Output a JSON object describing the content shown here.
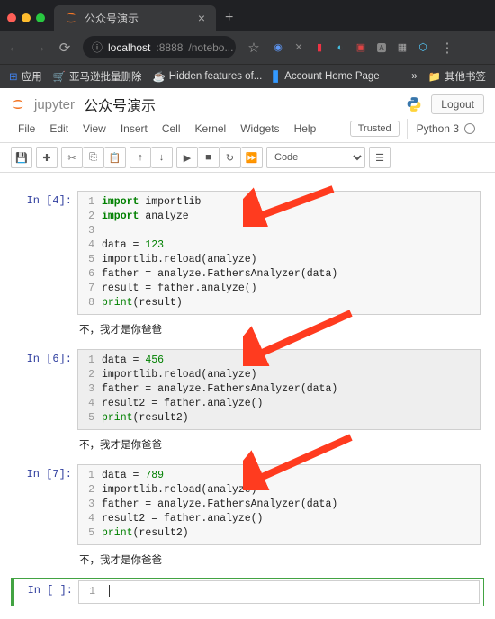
{
  "browser": {
    "tab_title": "公众号演示",
    "url_host": "localhost",
    "url_port": ":8888",
    "url_rest": "/notebo...",
    "bookmarks": {
      "apps": "应用",
      "amazon": "亚马逊批量删除",
      "hidden": "Hidden features of...",
      "account": "Account Home Page",
      "more": "»",
      "other": "其他书签"
    }
  },
  "jupyter": {
    "brand": "jupyter",
    "title": "公众号演示",
    "logout": "Logout",
    "menus": {
      "file": "File",
      "edit": "Edit",
      "view": "View",
      "insert": "Insert",
      "cell": "Cell",
      "kernel": "Kernel",
      "widgets": "Widgets",
      "help": "Help"
    },
    "trusted": "Trusted",
    "kernel": "Python 3",
    "cell_type": "Code"
  },
  "cells": [
    {
      "prompt": "In [4]:",
      "lines": [
        [
          {
            "t": "import",
            "c": "tok-kw"
          },
          {
            "t": " importlib"
          }
        ],
        [
          {
            "t": "import",
            "c": "tok-kw"
          },
          {
            "t": " analyze"
          }
        ],
        [],
        [
          {
            "t": "data = "
          },
          {
            "t": "123",
            "c": "tok-num"
          }
        ],
        [
          {
            "t": "importlib.reload(analyze)"
          }
        ],
        [
          {
            "t": "father = analyze.FathersAnalyzer(data)"
          }
        ],
        [
          {
            "t": "result = father.analyze()"
          }
        ],
        [
          {
            "t": "print",
            "c": "tok-builtin"
          },
          {
            "t": "(result)"
          }
        ]
      ],
      "output": "不，我才是你爸爸"
    },
    {
      "prompt": "In [6]:",
      "lines": [
        [
          {
            "t": "data = "
          },
          {
            "t": "456",
            "c": "tok-num"
          }
        ],
        [
          {
            "t": "importlib.reload(analyze)"
          }
        ],
        [
          {
            "t": "father = analyze.FathersAnalyzer(data)"
          }
        ],
        [
          {
            "t": "result2 = father.analyze()"
          }
        ],
        [
          {
            "t": "print",
            "c": "tok-builtin"
          },
          {
            "t": "(result2)"
          }
        ]
      ],
      "output": "不，我才是你爸爸",
      "selected": true
    },
    {
      "prompt": "In [7]:",
      "lines": [
        [
          {
            "t": "data = "
          },
          {
            "t": "789",
            "c": "tok-num"
          }
        ],
        [
          {
            "t": "importlib.reload(analyze)"
          }
        ],
        [
          {
            "t": "father = analyze.FathersAnalyzer(data)"
          }
        ],
        [
          {
            "t": "result2 = father.analyze()"
          }
        ],
        [
          {
            "t": "print",
            "c": "tok-builtin"
          },
          {
            "t": "(result2)"
          }
        ]
      ],
      "output": "不，我才是你爸爸"
    },
    {
      "prompt": "In [ ]:",
      "lines": [
        []
      ],
      "active": true
    }
  ]
}
